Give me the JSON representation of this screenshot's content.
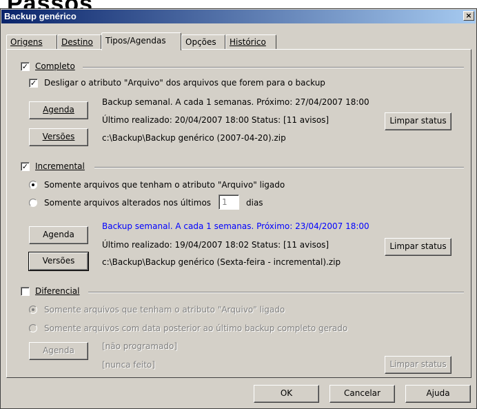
{
  "bg_word": "Passos",
  "window": {
    "title": "Backup genérico",
    "close_glyph": "×"
  },
  "tabs": [
    {
      "label": "Origens",
      "active": false
    },
    {
      "label": "Destino",
      "active": false
    },
    {
      "label": "Tipos/Agendas",
      "active": true
    },
    {
      "label": "Opções",
      "active": false
    },
    {
      "label": "Histórico",
      "active": false
    }
  ],
  "completo": {
    "label": "Completo",
    "checked": true,
    "option": "Desligar o atributo \"Arquivo\" dos arquivos que forem para o backup",
    "agenda_btn": "Agenda",
    "versoes_btn": "Versões",
    "schedule": "Backup semanal. A cada 1 semanas. Próximo: 27/04/2007 18:00",
    "last": "Último realizado: 20/04/2007 18:00  Status: [11 avisos]",
    "path": "c:\\Backup\\Backup genérico (2007-04-20).zip",
    "clear_btn": "Limpar status"
  },
  "incremental": {
    "label": "Incremental",
    "checked": true,
    "radio1": "Somente arquivos que tenham o atributo \"Arquivo\" ligado",
    "radio2": "Somente arquivos alterados nos últimos",
    "days_value": "1",
    "days_label": "dias",
    "agenda_btn": "Agenda",
    "versoes_btn": "Versões",
    "schedule": "Backup semanal. A cada 1 semanas. Próximo: 23/04/2007 18:00",
    "last": "Último realizado: 19/04/2007 18:02  Status: [11 avisos]",
    "path": "c:\\Backup\\Backup genérico (Sexta-feira - incremental).zip",
    "clear_btn": "Limpar status"
  },
  "diferencial": {
    "label": "Diferencial",
    "checked": false,
    "radio1": "Somente arquivos que tenham o atributo \"Arquivo\" ligado",
    "radio2": "Somente arquivos com data posterior ao último backup completo gerado",
    "agenda_btn": "Agenda",
    "schedule": "[não programado]",
    "last": "[nunca feito]",
    "clear_btn": "Limpar status"
  },
  "footer": {
    "ok": "OK",
    "cancel": "Cancelar",
    "help": "Ajuda"
  },
  "colors": {
    "title_bar": "#0a246a",
    "face": "#d4d0c8",
    "link_blue": "#0000ff"
  }
}
